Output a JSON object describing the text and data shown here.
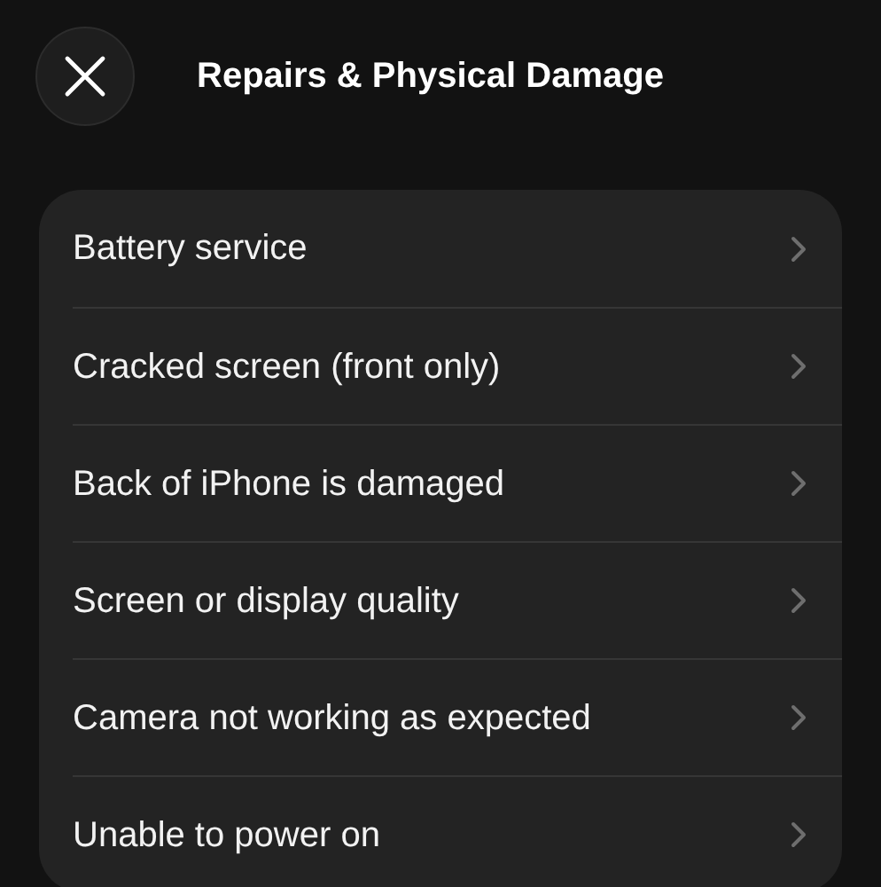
{
  "header": {
    "title": "Repairs & Physical Damage"
  },
  "options": [
    {
      "label": "Battery service"
    },
    {
      "label": "Cracked screen (front only)"
    },
    {
      "label": "Back of iPhone is damaged"
    },
    {
      "label": "Screen or display quality"
    },
    {
      "label": "Camera not working as expected"
    },
    {
      "label": "Unable to power on"
    }
  ]
}
